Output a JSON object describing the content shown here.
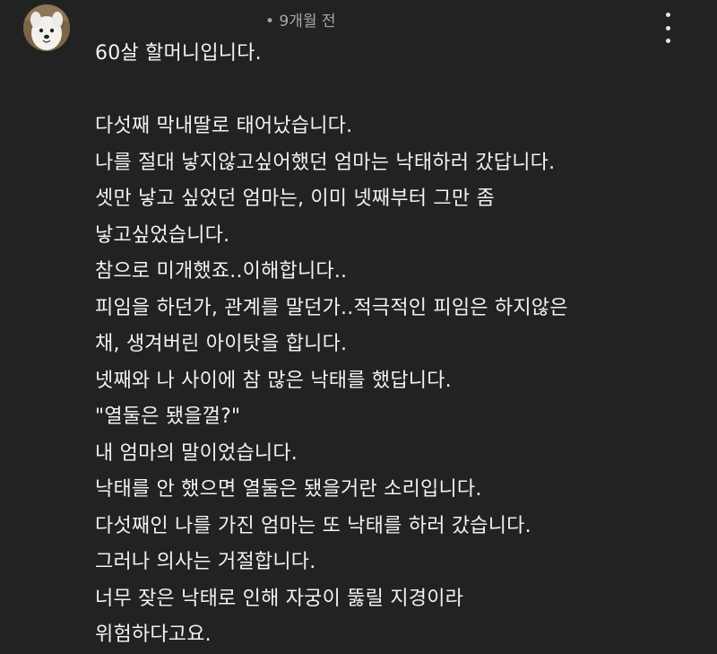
{
  "header": {
    "timestamp": "• 9개월 전"
  },
  "icons": {
    "avatar": "samoyed-dog-avatar",
    "menu": "kebab-menu-icon"
  },
  "comment": {
    "lines": [
      "60살 할머니입니다.",
      "",
      "다섯째 막내딸로 태어났습니다.",
      "나를 절대 낳지않고싶어했던 엄마는 낙태하러 갔답니다.",
      "셋만 낳고 싶었던 엄마는, 이미 넷째부터 그만 좀",
      "낳고싶었습니다.",
      "참으로 미개했죠..이해합니다..",
      "피임을 하던가, 관계를 말던가..적극적인 피임은 하지않은",
      "채, 생겨버린 아이탓을 합니다.",
      "넷째와 나 사이에 참 많은 낙태를 했답니다.",
      "\"열둘은 됐을껄?\"",
      "내 엄마의 말이었습니다.",
      "낙태를 안 했으면 열둘은 됐을거란 소리입니다.",
      "다섯째인 나를 가진 엄마는 또 낙태를 하러 갔습니다.",
      "그러나 의사는 거절합니다.",
      "너무 잦은 낙태로 인해 자궁이 뚫릴 지경이라",
      "위험하다고요."
    ]
  },
  "colors": {
    "background": "#222222",
    "text": "#f2f2f2",
    "meta": "#a8a8a8"
  }
}
